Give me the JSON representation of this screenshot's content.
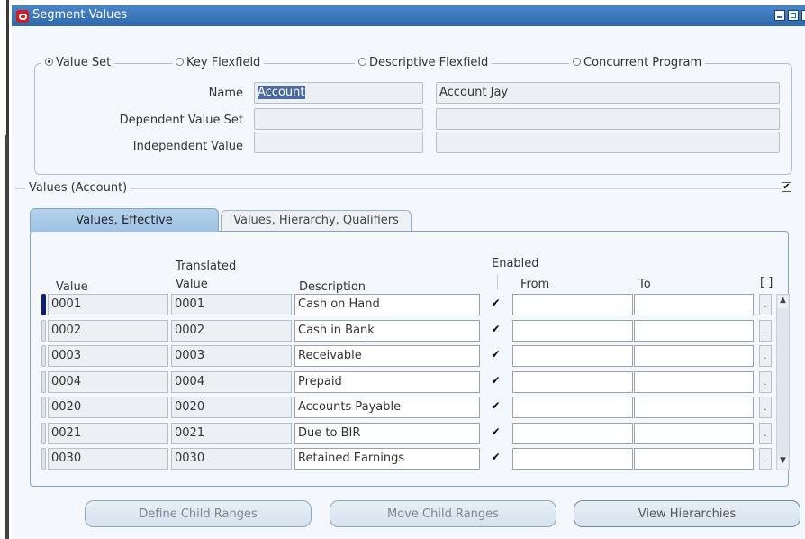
{
  "window": {
    "title": "Segment Values"
  },
  "radios": {
    "value_set": "Value Set",
    "key_flexfield": "Key Flexfield",
    "descriptive_flexfield": "Descriptive Flexfield",
    "concurrent_program": "Concurrent Program",
    "selected": "value_set"
  },
  "form": {
    "name_label": "Name",
    "name_value": "Account",
    "name_desc": "Account Jay",
    "dependent_label": "Dependent Value Set",
    "independent_label": "Independent Value"
  },
  "section": {
    "title": "Values (Account)"
  },
  "tabs": [
    {
      "label": "Values, Effective",
      "active": true
    },
    {
      "label": "Values, Hierarchy, Qualifiers",
      "active": false
    }
  ],
  "columns": {
    "value": "Value",
    "translated_top": "Translated",
    "translated_bottom": "Value",
    "description": "Description",
    "enabled": "Enabled",
    "from": "From",
    "to": "To",
    "dff": "[ ]"
  },
  "rows": [
    {
      "value": "0001",
      "translated": "0001",
      "description": "Cash on Hand",
      "enabled": "✔",
      "more": "."
    },
    {
      "value": "0002",
      "translated": "0002",
      "description": "Cash in Bank",
      "enabled": "✔",
      "more": "."
    },
    {
      "value": "0003",
      "translated": "0003",
      "description": "Receivable",
      "enabled": "✔",
      "more": "."
    },
    {
      "value": "0004",
      "translated": "0004",
      "description": "Prepaid",
      "enabled": "✔",
      "more": "."
    },
    {
      "value": "0020",
      "translated": "0020",
      "description": "Accounts Payable",
      "enabled": "✔",
      "more": "."
    },
    {
      "value": "0021",
      "translated": "0021",
      "description": "Due to BIR",
      "enabled": "✔",
      "more": "."
    },
    {
      "value": "0030",
      "translated": "0030",
      "description": "Retained Earnings",
      "enabled": "✔",
      "more": "."
    }
  ],
  "buttons": {
    "define_child_ranges": "Define Child Ranges",
    "move_child_ranges": "Move Child Ranges",
    "view_hierarchies": "View Hierarchies"
  },
  "glyphs": {
    "check": "✔",
    "up": "▲",
    "down": "▼"
  },
  "colors": {
    "titlebar": "#2f69ad",
    "active_tab": "#9ec3e6",
    "selected_text_bg": "#4a6aa0"
  }
}
